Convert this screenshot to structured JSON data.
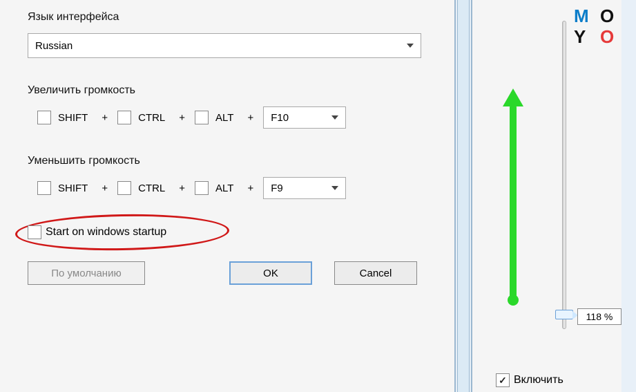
{
  "logo": {
    "m": "M",
    "o1": "O",
    "y": "Y",
    "o2": "O"
  },
  "left": {
    "language_label": "Язык интерфейса",
    "language_value": "Russian",
    "increase_label": "Увеличить громкость",
    "decrease_label": "Уменьшить громкость",
    "mods": {
      "shift": "SHIFT",
      "ctrl": "CTRL",
      "alt": "ALT"
    },
    "plus": "+",
    "increase_key": "F10",
    "decrease_key": "F9",
    "startup_label": "Start on windows startup",
    "default_btn": "По умолчанию",
    "ok_btn": "OK",
    "cancel_btn": "Cancel"
  },
  "right": {
    "percent": "118 %",
    "enable_label": "Включить"
  }
}
